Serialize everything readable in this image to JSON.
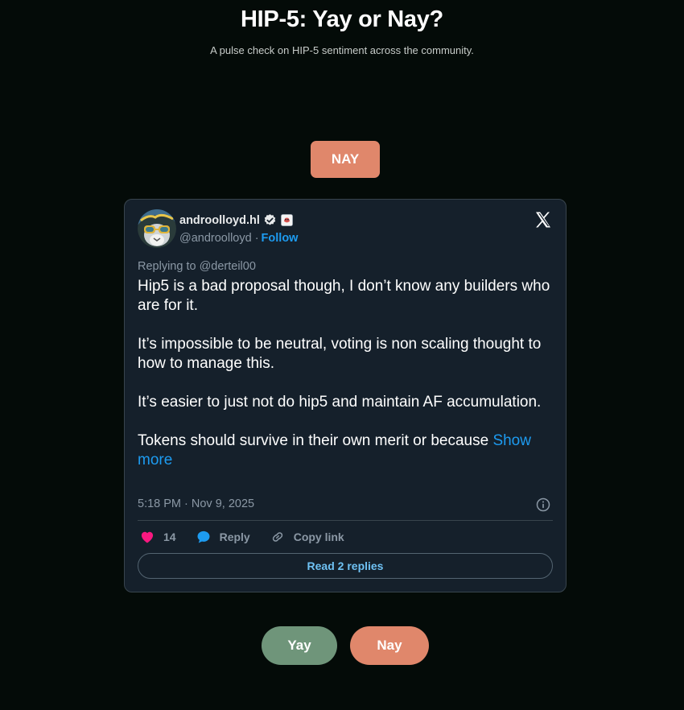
{
  "header": {
    "title": "HIP-5: Yay or Nay?",
    "subtitle": "A pulse check on HIP-5 sentiment across the community."
  },
  "verdict": {
    "label": "NAY",
    "color": "#e0876b"
  },
  "tweet": {
    "display_name": "androolloyd.hl",
    "handle": "@androolloyd",
    "separator": "·",
    "follow_label": "Follow",
    "replying_to": "Replying to @derteil00",
    "paragraphs": [
      "Hip5 is a bad proposal though, I don’t know any builders who are for it.",
      "It’s impossible to be neutral, voting is non scaling thought to how to manage this.",
      "It’s easier to just not do hip5 and maintain AF accumulation."
    ],
    "last_paragraph": "Tokens should survive in their own merit or because ",
    "show_more_label": "Show more",
    "timestamp": "5:18 PM · Nov 9, 2025",
    "like_count": "14",
    "reply_label": "Reply",
    "copy_link_label": "Copy link",
    "read_replies_label": "Read 2 replies",
    "icons": [
      "verified-badge-icon",
      "affiliate-badge-icon",
      "x-logo-icon",
      "info-icon",
      "heart-icon",
      "reply-bubble-icon",
      "link-icon"
    ]
  },
  "vote_buttons": {
    "yay_label": "Yay",
    "nay_label": "Nay",
    "yay_color": "#6f957a",
    "nay_color": "#e0876b"
  }
}
